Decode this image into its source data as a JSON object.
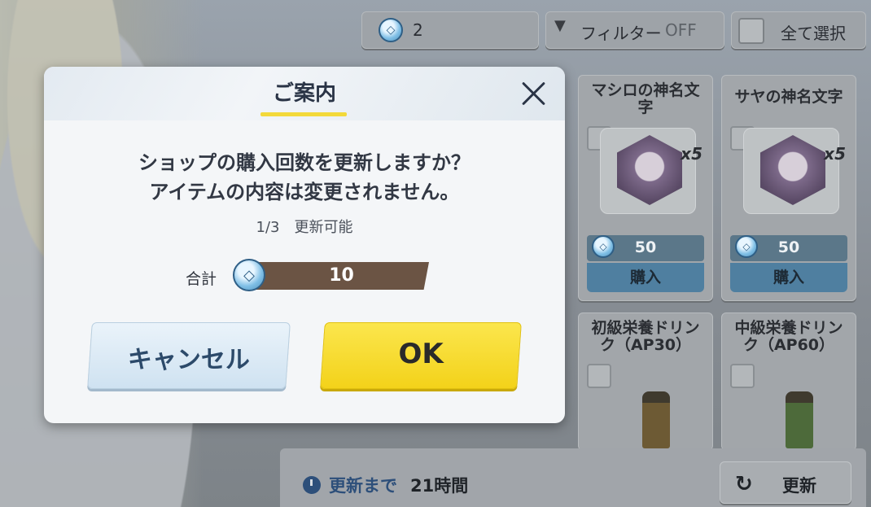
{
  "header": {
    "currency_count": "2",
    "filter_label": "フィルター",
    "filter_state": "OFF",
    "select_all_label": "全て選択"
  },
  "items": [
    {
      "name": "マシロの神名文字",
      "qty": "x5",
      "price": "50",
      "buy_label": "購入"
    },
    {
      "name": "サヤの神名文字",
      "qty": "x5",
      "price": "50",
      "buy_label": "購入"
    },
    {
      "name": "初級栄養ドリンク（AP30）"
    },
    {
      "name": "中級栄養ドリンク（AP60）"
    }
  ],
  "footer": {
    "refresh_until_label": "更新まで",
    "refresh_until_value": "21時間",
    "refresh_button_label": "更新"
  },
  "modal": {
    "title": "ご案内",
    "message_line1": "ショップの購入回数を更新しますか？",
    "message_line2": "アイテムの内容は変更されません。",
    "refresh_count": "1/3　更新可能",
    "total_label": "合計",
    "total_value": "10",
    "cancel_label": "キャンセル",
    "ok_label": "OK"
  },
  "colors": {
    "ok_button": "#f5d828",
    "cancel_button": "#dce9f4",
    "title_underline": "#f3d93a",
    "total_bar": "#6b5444"
  },
  "icons": [
    "currency-coin-icon",
    "filter-icon",
    "checkbox-icon",
    "close-icon",
    "clock-icon",
    "refresh-icon"
  ]
}
